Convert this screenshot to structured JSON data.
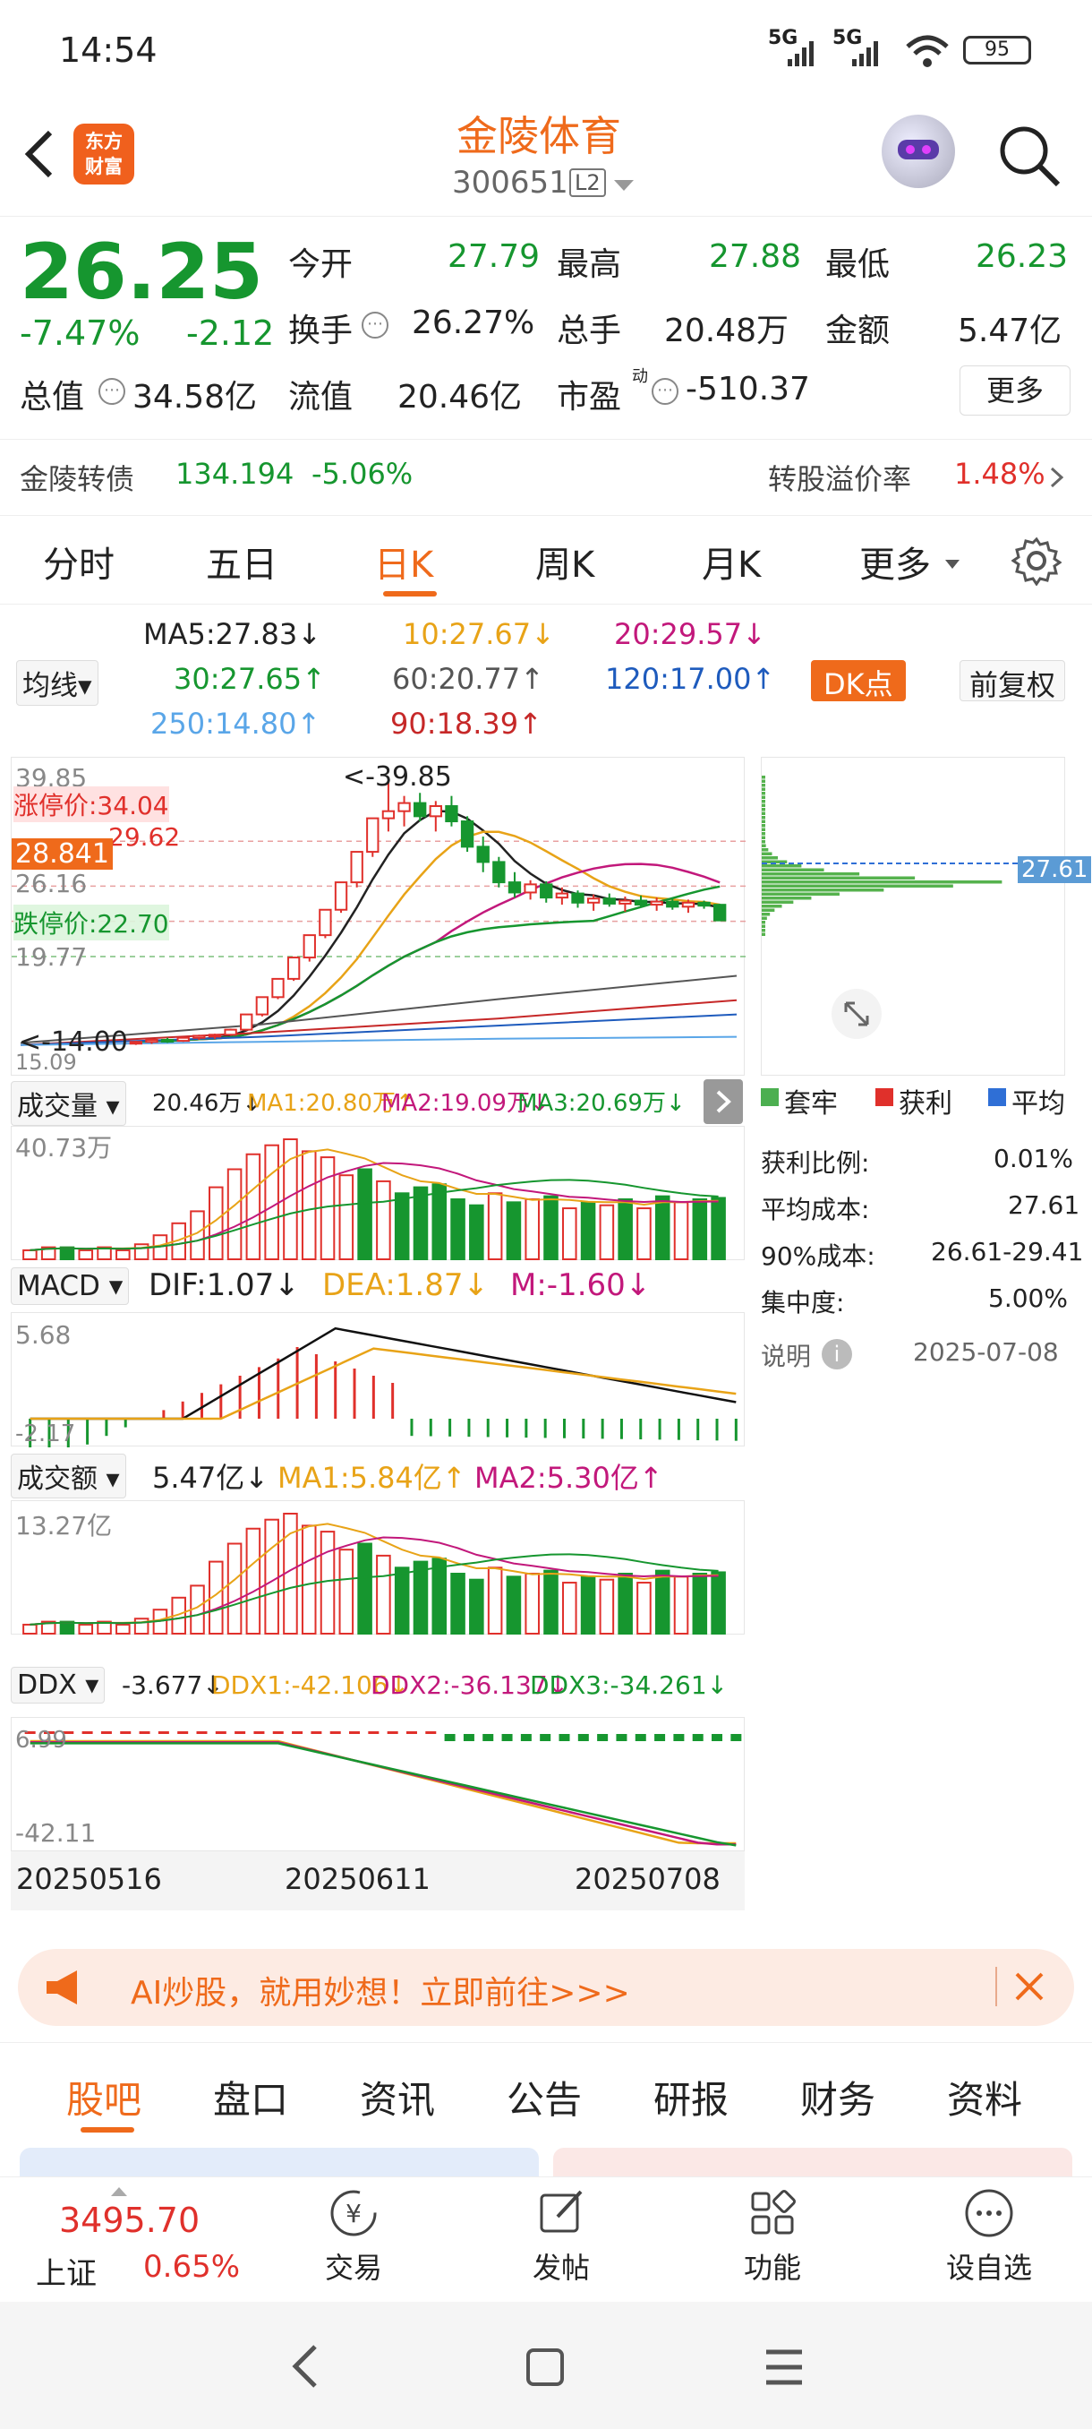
{
  "status_bar": {
    "time": "14:54",
    "signal1": "5G",
    "signal2": "5G",
    "battery": "95"
  },
  "header": {
    "title": "金陵体育",
    "code": "300651",
    "level": "L2",
    "logo_line1": "东方",
    "logo_line2": "财富"
  },
  "quote": {
    "price": "26.25",
    "change_pct": "-7.47%",
    "change": "-2.12",
    "open_label": "今开",
    "open": "27.79",
    "high_label": "最高",
    "high": "27.88",
    "low_label": "最低",
    "low": "26.23",
    "turnover_label": "换手",
    "turnover": "26.27%",
    "volume_label": "总手",
    "volume": "20.48万",
    "amount_label": "金额",
    "amount": "5.47亿",
    "mktcap_label": "总值",
    "mktcap": "34.58亿",
    "float_label": "流值",
    "float": "20.46亿",
    "pe_label": "市盈",
    "pe_sup": "动",
    "pe": "-510.37",
    "more_button": "更多",
    "bond_name": "金陵转债",
    "bond_price": "134.194",
    "bond_pct": "-5.06%",
    "premium_label": "转股溢价率",
    "premium": "1.48%"
  },
  "period_tabs": [
    "分时",
    "五日",
    "日K",
    "周K",
    "月K",
    "更多"
  ],
  "active_tab": "日K",
  "ma_legend": {
    "selector": "均线",
    "ma5": "MA5:27.83",
    "ma10": "10:27.67",
    "ma20": "20:29.57",
    "ma30": "30:27.65",
    "ma60": "60:20.77",
    "ma120": "120:17.00",
    "ma250": "250:14.80",
    "ma90": "90:18.39",
    "dk_button": "DK点",
    "adjust_button": "前复权"
  },
  "kline_labels": {
    "high_axis": "39.85",
    "high_marker": "<-39.85",
    "limit_up": "涨停价:34.04",
    "level2": "29.62",
    "current_tag": "28.841",
    "level3": "26.16",
    "limit_down": "跌停价:22.70",
    "level4": "19.77",
    "low_marker": "<-14.00",
    "low_axis": "15.09",
    "chip_price": "27.61"
  },
  "chip_panel": {
    "legend_trapped": "套牢",
    "legend_profit": "获利",
    "legend_avg": "平均",
    "profit_ratio_label": "获利比例:",
    "profit_ratio": "0.01%",
    "avg_cost_label": "平均成本:",
    "avg_cost": "27.61",
    "cost90_label": "90%成本:",
    "cost90": "26.61-29.41",
    "concentration_label": "集中度:",
    "concentration": "5.00%",
    "note_label": "说明",
    "date": "2025-07-08"
  },
  "volume_panel": {
    "selector": "成交量",
    "value": "20.46万",
    "ma1": "MA1:20.80万",
    "ma2": "MA2:19.09万",
    "ma3": "MA3:20.69万",
    "axis_top": "40.73万"
  },
  "macd_panel": {
    "selector": "MACD",
    "dif": "DIF:1.07",
    "dea": "DEA:1.87",
    "m": "M:-1.60",
    "axis_top": "5.68",
    "axis_bottom": "-2.17"
  },
  "amount_panel": {
    "selector": "成交额",
    "value": "5.47亿",
    "ma1": "MA1:5.84亿",
    "ma2": "MA2:5.30亿",
    "axis_top": "13.27亿"
  },
  "ddx_panel": {
    "selector": "DDX",
    "value": "-3.677",
    "ddx1": "DDX1:-42.106",
    "ddx2": "DDX2:-36.137",
    "ddx3": "DDX3:-34.261",
    "axis_top": "6.99",
    "axis_bottom": "-42.11"
  },
  "dates": [
    "20250516",
    "20250611",
    "20250708"
  ],
  "banner": {
    "text": "AI炒股，就用妙想！立即前往>>>"
  },
  "content_tabs": [
    "股吧",
    "盘口",
    "资讯",
    "公告",
    "研报",
    "财务",
    "资料"
  ],
  "bottom_bar": {
    "index_value": "3495.70",
    "index_name": "上证",
    "index_pct": "0.65%",
    "trade": "交易",
    "post": "发帖",
    "functions": "功能",
    "watchlist": "设自选"
  },
  "colors": {
    "up": "#e0302b",
    "down": "#16962f",
    "accent": "#ef6a1b"
  },
  "chart_data": {
    "type": "candlestick",
    "dates": [
      "20250516",
      "20250611",
      "20250708"
    ],
    "price_range": [
      14.0,
      39.85
    ],
    "candles_approx": [
      [
        14.2,
        14.4,
        14.0,
        14.3
      ],
      [
        14.3,
        14.6,
        14.1,
        14.5
      ],
      [
        14.5,
        14.7,
        14.2,
        14.4
      ],
      [
        14.4,
        14.8,
        14.3,
        14.7
      ],
      [
        14.7,
        15.0,
        14.5,
        14.9
      ],
      [
        14.9,
        15.1,
        14.6,
        15.0
      ],
      [
        15.0,
        15.6,
        14.9,
        15.5
      ],
      [
        15.5,
        17.0,
        15.4,
        17.0
      ],
      [
        17.0,
        18.7,
        16.8,
        18.7
      ],
      [
        18.7,
        20.5,
        18.5,
        20.5
      ],
      [
        20.5,
        22.6,
        20.3,
        22.6
      ],
      [
        22.6,
        24.8,
        22.2,
        24.8
      ],
      [
        24.8,
        27.3,
        24.5,
        27.3
      ],
      [
        27.3,
        30.0,
        27.0,
        30.0
      ],
      [
        30.0,
        33.0,
        29.5,
        33.0
      ],
      [
        33.0,
        36.3,
        32.5,
        36.3
      ],
      [
        36.3,
        39.85,
        35.0,
        37.0
      ],
      [
        37.0,
        38.5,
        35.5,
        37.8
      ],
      [
        37.8,
        38.8,
        36.0,
        36.5
      ],
      [
        36.5,
        38.0,
        35.0,
        37.5
      ],
      [
        37.5,
        38.5,
        35.5,
        36.0
      ],
      [
        36.0,
        36.5,
        33.0,
        33.5
      ],
      [
        33.5,
        34.5,
        31.0,
        32.0
      ],
      [
        32.0,
        32.5,
        29.5,
        30.0
      ],
      [
        30.0,
        31.0,
        28.5,
        29.0
      ],
      [
        29.0,
        30.2,
        28.3,
        29.8
      ],
      [
        29.8,
        30.1,
        28.0,
        28.5
      ],
      [
        28.5,
        29.5,
        27.8,
        28.9
      ],
      [
        28.9,
        29.2,
        27.5,
        28.0
      ],
      [
        28.0,
        28.8,
        27.2,
        28.4
      ],
      [
        28.4,
        28.9,
        27.6,
        27.9
      ],
      [
        27.9,
        28.6,
        27.1,
        28.2
      ],
      [
        28.2,
        28.7,
        27.5,
        27.8
      ],
      [
        27.8,
        28.5,
        27.2,
        28.1
      ],
      [
        28.1,
        28.4,
        27.3,
        27.6
      ],
      [
        27.6,
        28.3,
        27.0,
        28.0
      ],
      [
        28.0,
        28.2,
        27.4,
        27.7
      ],
      [
        27.79,
        27.88,
        26.23,
        26.25
      ]
    ],
    "volume_wan_approx": [
      3,
      4,
      4,
      3,
      4,
      3,
      5,
      8,
      12,
      16,
      24,
      30,
      35,
      38,
      40,
      36,
      34,
      28,
      30,
      26,
      22,
      24,
      25,
      20,
      18,
      22,
      19,
      20,
      21,
      17,
      19,
      18,
      20,
      17,
      21,
      19,
      20,
      20.46
    ],
    "volume_axis_top": "40.73万",
    "macd_range": [
      -2.17,
      5.68
    ],
    "amount_axis_top": "13.27亿",
    "ddx_range": [
      -42.11,
      6.99
    ]
  }
}
